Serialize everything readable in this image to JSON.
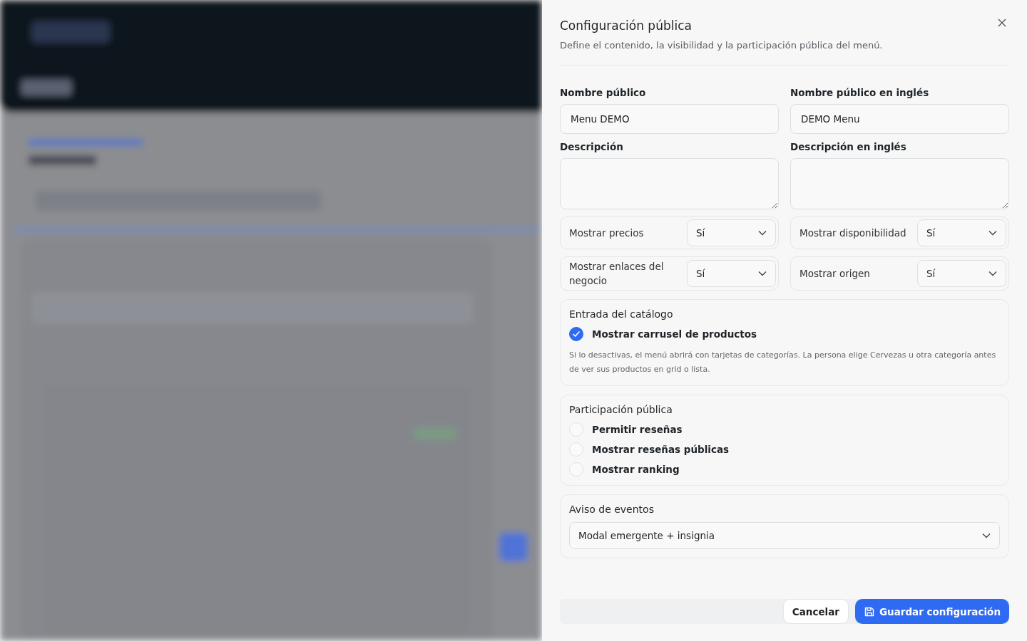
{
  "panel": {
    "title": "Configuración pública",
    "subtitle": "Define el contenido, la visibilidad y la participación pública del menú.",
    "fields": [
      {
        "kind": "input",
        "label": "Nombre público",
        "value": "Menu DEMO"
      },
      {
        "kind": "input",
        "label": "Nombre público en inglés",
        "value": "DEMO Menu"
      },
      {
        "kind": "textarea",
        "label": "Descripción"
      },
      {
        "kind": "textarea",
        "label": "Descripción en inglés"
      }
    ],
    "selects": [
      {
        "label": "Mostrar precios",
        "value": "Sí"
      },
      {
        "label": "Mostrar disponibilidad",
        "value": "Sí"
      },
      {
        "label": "Mostrar enlaces del negocio",
        "value": "Sí"
      },
      {
        "label": "Mostrar origen",
        "value": "Sí"
      }
    ],
    "catalog": {
      "title": "Entrada del catálogo",
      "options": [
        {
          "label": "Mostrar carrusel de productos",
          "checked": true
        }
      ],
      "hint": "Si lo desactivas, el menú abrirá con tarjetas de categorías. La persona elige Cervezas u otra categoría antes de ver sus productos en grid o lista."
    },
    "participation": {
      "title": "Participación pública",
      "options": [
        {
          "label": "Permitir reseñas",
          "checked": false
        },
        {
          "label": "Mostrar reseñas públicas",
          "checked": false
        },
        {
          "label": "Mostrar ranking",
          "checked": false
        }
      ]
    },
    "events": {
      "title": "Aviso de eventos",
      "value": "Modal emergente + insignia"
    },
    "buttons": {
      "cancel": "Cancelar",
      "save": "Guardar configuración"
    }
  }
}
